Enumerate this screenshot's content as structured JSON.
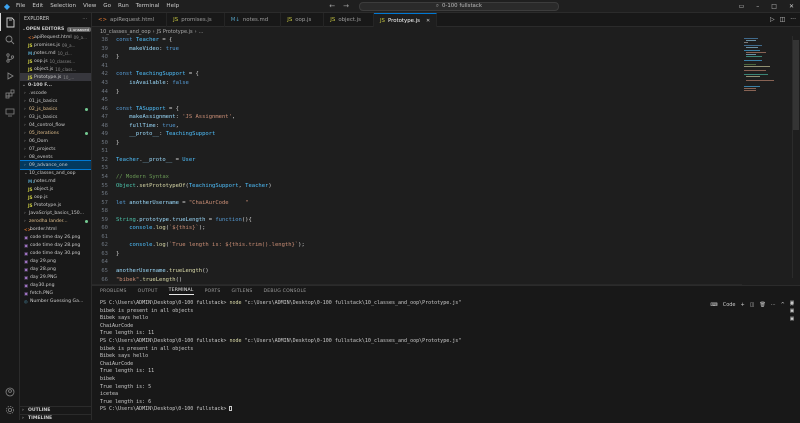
{
  "titlebar": {
    "menu": [
      "File",
      "Edit",
      "Selection",
      "View",
      "Go",
      "Run",
      "Terminal",
      "Help"
    ],
    "search": "0-100 fullstack"
  },
  "sidebar": {
    "title": "EXPLORER",
    "open_editors": {
      "label": "OPEN EDITORS",
      "badge": "1 unsaved"
    },
    "open_items": [
      {
        "name": "apiRequest.html",
        "dim": "09_a...",
        "icon": "html"
      },
      {
        "name": "promises.js",
        "dim": "09_a...",
        "icon": "js"
      },
      {
        "name": "notes.md",
        "dim": "10_cl...",
        "icon": "md"
      },
      {
        "name": "oop.js",
        "dim": "10_classes...",
        "icon": "js"
      },
      {
        "name": "object.js",
        "dim": "10_class...",
        "icon": "js"
      },
      {
        "name": "Prototype.js",
        "dim": "10_...",
        "icon": "js",
        "active": true
      }
    ],
    "root": "0-100 F...",
    "tree": [
      {
        "name": ".vscode",
        "type": "folder",
        "indent": 1
      },
      {
        "name": "01_js_basics",
        "type": "folder",
        "indent": 1
      },
      {
        "name": "02_js_basics",
        "type": "folder",
        "indent": 1,
        "modified": true
      },
      {
        "name": "03_js_basics",
        "type": "folder",
        "indent": 1
      },
      {
        "name": "04_control_flow",
        "type": "folder",
        "indent": 1
      },
      {
        "name": "05_iterations",
        "type": "folder",
        "indent": 1,
        "modified": true
      },
      {
        "name": "06_Dom",
        "type": "folder",
        "indent": 1
      },
      {
        "name": "07_projects",
        "type": "folder",
        "indent": 1
      },
      {
        "name": "08_events",
        "type": "folder",
        "indent": 1
      },
      {
        "name": "09_advance_one",
        "type": "folder",
        "indent": 1,
        "selected": true
      },
      {
        "name": "10_classes_and_oop",
        "type": "folder-open",
        "indent": 1
      },
      {
        "name": "notes.md",
        "type": "md",
        "indent": 2
      },
      {
        "name": "object.js",
        "type": "js",
        "indent": 2
      },
      {
        "name": "oop.js",
        "type": "js",
        "indent": 2
      },
      {
        "name": "Prototype.js",
        "type": "js",
        "indent": 2
      },
      {
        "name": "JavaScript_basics_150...",
        "type": "folder",
        "indent": 1
      },
      {
        "name": "zerodha lander...",
        "type": "folder",
        "indent": 1,
        "modified": true
      },
      {
        "name": "border.html",
        "type": "html",
        "indent": 1
      },
      {
        "name": "code time day 26.png",
        "type": "png",
        "indent": 1
      },
      {
        "name": "code time day 28.png",
        "type": "png",
        "indent": 1
      },
      {
        "name": "code time day 30.png",
        "type": "png",
        "indent": 1
      },
      {
        "name": "day 29.png",
        "type": "png",
        "indent": 1
      },
      {
        "name": "day 28.png",
        "type": "png",
        "indent": 1
      },
      {
        "name": "day 29.PNG",
        "type": "png",
        "indent": 1
      },
      {
        "name": "day30.png",
        "type": "png",
        "indent": 1
      },
      {
        "name": "fetch.PNG",
        "type": "png",
        "indent": 1
      },
      {
        "name": "Number Guessing Ga...",
        "type": "other",
        "indent": 1
      }
    ],
    "outline": "OUTLINE",
    "timeline": "TIMELINE"
  },
  "tabs": [
    {
      "name": "apiRequest.html",
      "icon": "html"
    },
    {
      "name": "promises.js",
      "icon": "js"
    },
    {
      "name": "notes.md",
      "icon": "md"
    },
    {
      "name": "oop.js",
      "icon": "js"
    },
    {
      "name": "object.js",
      "icon": "js"
    },
    {
      "name": "Prototype.js",
      "icon": "js",
      "active": true
    }
  ],
  "breadcrumb": [
    "10_classes_and_oop",
    "JS Prototype.js",
    "..."
  ],
  "editor": {
    "current_line": 67,
    "lines": [
      {
        "n": 38,
        "code": "const Teacher = {"
      },
      {
        "n": 39,
        "code": "    makeVideo: true"
      },
      {
        "n": 40,
        "code": "}"
      },
      {
        "n": 41,
        "code": ""
      },
      {
        "n": 42,
        "code": "const TeachingSupport = {"
      },
      {
        "n": 43,
        "code": "    isAvailable: false"
      },
      {
        "n": 44,
        "code": "}"
      },
      {
        "n": 45,
        "code": ""
      },
      {
        "n": 46,
        "code": "const TASupport = {"
      },
      {
        "n": 47,
        "code": "    makeAssignment: 'JS Assignment',"
      },
      {
        "n": 48,
        "code": "    fullTime: true,"
      },
      {
        "n": 49,
        "code": "    __proto__: TeachingSupport"
      },
      {
        "n": 50,
        "code": "}"
      },
      {
        "n": 51,
        "code": ""
      },
      {
        "n": 52,
        "code": "Teacher.__proto__ = User"
      },
      {
        "n": 53,
        "code": ""
      },
      {
        "n": 54,
        "code": "// Modern Syntax"
      },
      {
        "n": 55,
        "code": "Object.setPrototypeOf(TeachingSupport, Teacher)"
      },
      {
        "n": 56,
        "code": ""
      },
      {
        "n": 57,
        "code": "let anotherUsername = \"ChaiAurCode     \""
      },
      {
        "n": 58,
        "code": ""
      },
      {
        "n": 59,
        "code": "String.prototype.trueLength = function(){"
      },
      {
        "n": 60,
        "code": "    console.log(`${this}`);"
      },
      {
        "n": 61,
        "code": ""
      },
      {
        "n": 62,
        "code": "    console.log(`True length is: ${this.trim().length}`);"
      },
      {
        "n": 63,
        "code": "}"
      },
      {
        "n": 64,
        "code": ""
      },
      {
        "n": 65,
        "code": "anotherUsername.trueLength()"
      },
      {
        "n": 66,
        "code": "\"bibek\".trueLength()"
      },
      {
        "n": 67,
        "code": "\"iceteа\".trueLength()"
      }
    ]
  },
  "panel": {
    "tabs": [
      "PROBLEMS",
      "OUTPUT",
      "TERMINAL",
      "PORTS",
      "GITLENS",
      "DEBUG CONSOLE"
    ],
    "active_tab": "TERMINAL",
    "shell_label": "Code",
    "terminal_lines": [
      "PS C:\\Users\\ADMIN\\Desktop\\0-100 fullstack> node \"c:\\Users\\ADMIN\\Desktop\\0-100 fullstack\\10_classes_and_oop\\Prototype.js\"",
      "bibek is present in all objects",
      "Bibek says hello",
      "ChaiAurCode",
      "True length is: 11",
      "PS C:\\Users\\ADMIN\\Desktop\\0-100 fullstack> node \"c:\\Users\\ADMIN\\Desktop\\0-100 fullstack\\10_classes_and_oop\\Prototype.js\"",
      "bibek is present in all objects",
      "Bibek says hello",
      "ChaiAurCode",
      "True length is: 11",
      "bibek",
      "True length is: 5",
      "icetea",
      "True length is: 6",
      "PS C:\\Users\\ADMIN\\Desktop\\0-100 fullstack> "
    ]
  },
  "colors": {
    "accent": "#0078d4",
    "keyword": "#569cd6",
    "variable": "#4fc1ff",
    "property": "#9cdcfe",
    "string": "#ce9178",
    "comment": "#6a9955",
    "function": "#dcdcaa",
    "class": "#4ec9b0",
    "bool": "#569cd6"
  }
}
